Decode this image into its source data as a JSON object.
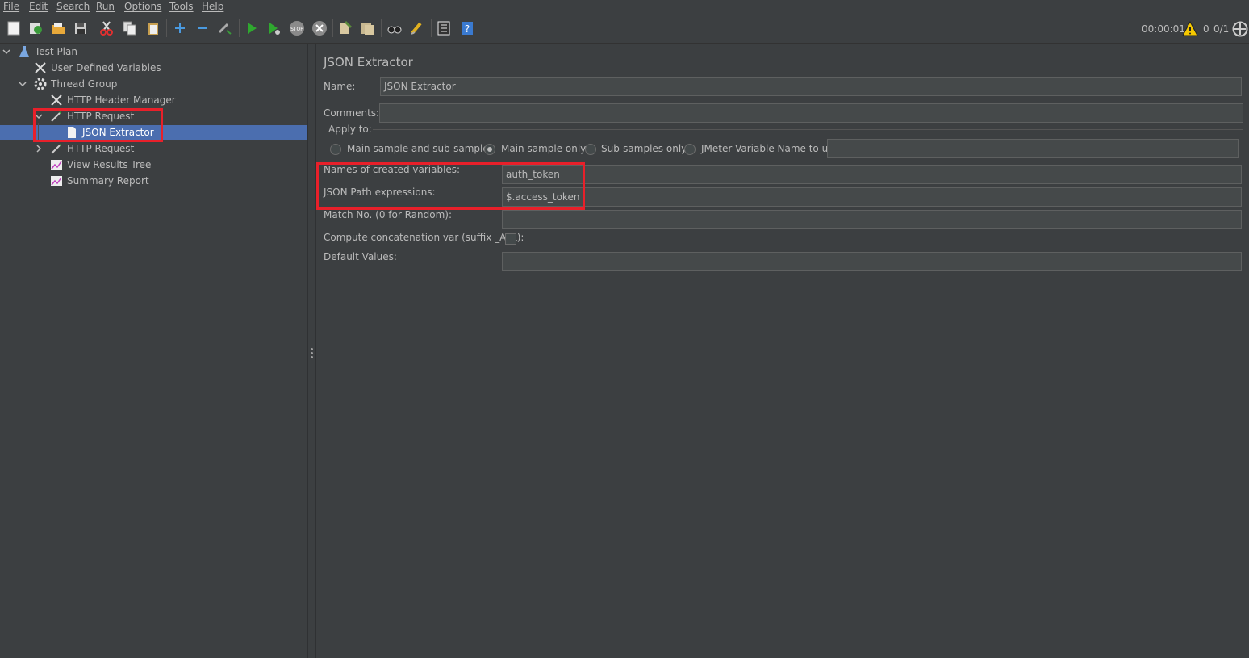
{
  "menu": {
    "items": [
      "File",
      "Edit",
      "Search",
      "Run",
      "Options",
      "Tools",
      "Help"
    ]
  },
  "toolbar": {
    "icons": [
      "new-icon",
      "templates-icon",
      "open-icon",
      "save-icon",
      "cut-icon",
      "copy-icon",
      "paste-icon",
      "expand-icon",
      "collapse-icon",
      "toggle-icon",
      "start-icon",
      "start-no-pauses-icon",
      "stop-icon",
      "shutdown-icon",
      "clear-icon",
      "clear-all-icon",
      "search-icon",
      "reset-search-icon",
      "function-helper-icon",
      "help-icon"
    ],
    "timer": "00:00:01",
    "warning_count": "0",
    "threads": "0/1"
  },
  "tree": {
    "items": [
      {
        "label": "Test Plan",
        "icon": "flask-icon"
      },
      {
        "label": "User Defined Variables",
        "icon": "wrench-icon"
      },
      {
        "label": "Thread Group",
        "icon": "gear-icon"
      },
      {
        "label": "HTTP Header Manager",
        "icon": "wrench-icon"
      },
      {
        "label": "HTTP Request",
        "icon": "pipette-icon"
      },
      {
        "label": "JSON Extractor",
        "icon": "document-icon"
      },
      {
        "label": "HTTP Request",
        "icon": "pipette-icon"
      },
      {
        "label": "View Results Tree",
        "icon": "graph-icon"
      },
      {
        "label": "Summary Report",
        "icon": "graph-icon"
      }
    ],
    "selected": "JSON Extractor"
  },
  "panel": {
    "title": "JSON Extractor",
    "name_label": "Name:",
    "name_value": "JSON Extractor",
    "comments_label": "Comments:",
    "comments_value": "",
    "apply_to_label": "Apply to:",
    "apply_options": [
      "Main sample and sub-samples",
      "Main sample only",
      "Sub-samples only",
      "JMeter Variable Name to use"
    ],
    "apply_selected": "Main sample only",
    "jmeter_var_value": "",
    "names_label": "Names of created variables:",
    "names_value": "auth_token",
    "jsonpath_label": "JSON Path expressions:",
    "jsonpath_value": "$.access_token",
    "match_label": "Match No. (0 for Random):",
    "match_value": "",
    "concat_label": "Compute concatenation var (suffix _ALL):",
    "concat_checked": false,
    "default_label": "Default Values:",
    "default_value": ""
  },
  "colors": {
    "background": "#3c3f41",
    "selection": "#4b6eaf",
    "highlight": "#e8202a",
    "field": "#45494a"
  }
}
